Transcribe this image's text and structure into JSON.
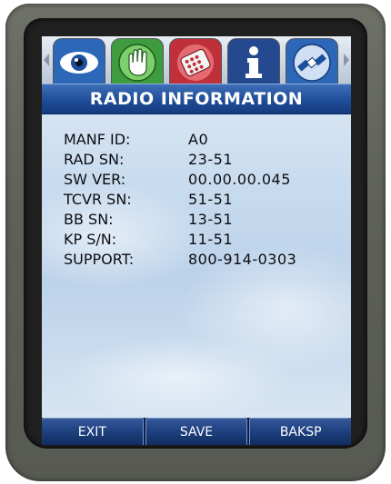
{
  "tabs": [
    {
      "icon": "eye-icon",
      "color": "#2c67b8"
    },
    {
      "icon": "hand-icon",
      "color": "#3f9c3e"
    },
    {
      "icon": "keypad-icon",
      "color": "#c0303a"
    },
    {
      "icon": "info-icon",
      "color": "#24498f",
      "active": true
    },
    {
      "icon": "satellite-icon",
      "color": "#2c67b8"
    }
  ],
  "header": {
    "title": "RADIO INFORMATION"
  },
  "info": {
    "rows": [
      {
        "label": "MANF ID:",
        "value": "A0"
      },
      {
        "label": "RAD SN:",
        "value": "23-51"
      },
      {
        "label": "SW VER:",
        "value": "00.00.00.045"
      },
      {
        "label": "TCVR SN:",
        "value": "51-51"
      },
      {
        "label": "BB SN:",
        "value": "13-51"
      },
      {
        "label": "KP S/N:",
        "value": "11-51"
      },
      {
        "label": "SUPPORT:",
        "value": "800-914-0303"
      }
    ]
  },
  "softkeys": {
    "exit": "EXIT",
    "save": "SAVE",
    "baksp": "BAKSP"
  },
  "colors": {
    "title_bar": "#1f4d99",
    "softkey": "#1d3f7d",
    "device": "#5d6058"
  }
}
